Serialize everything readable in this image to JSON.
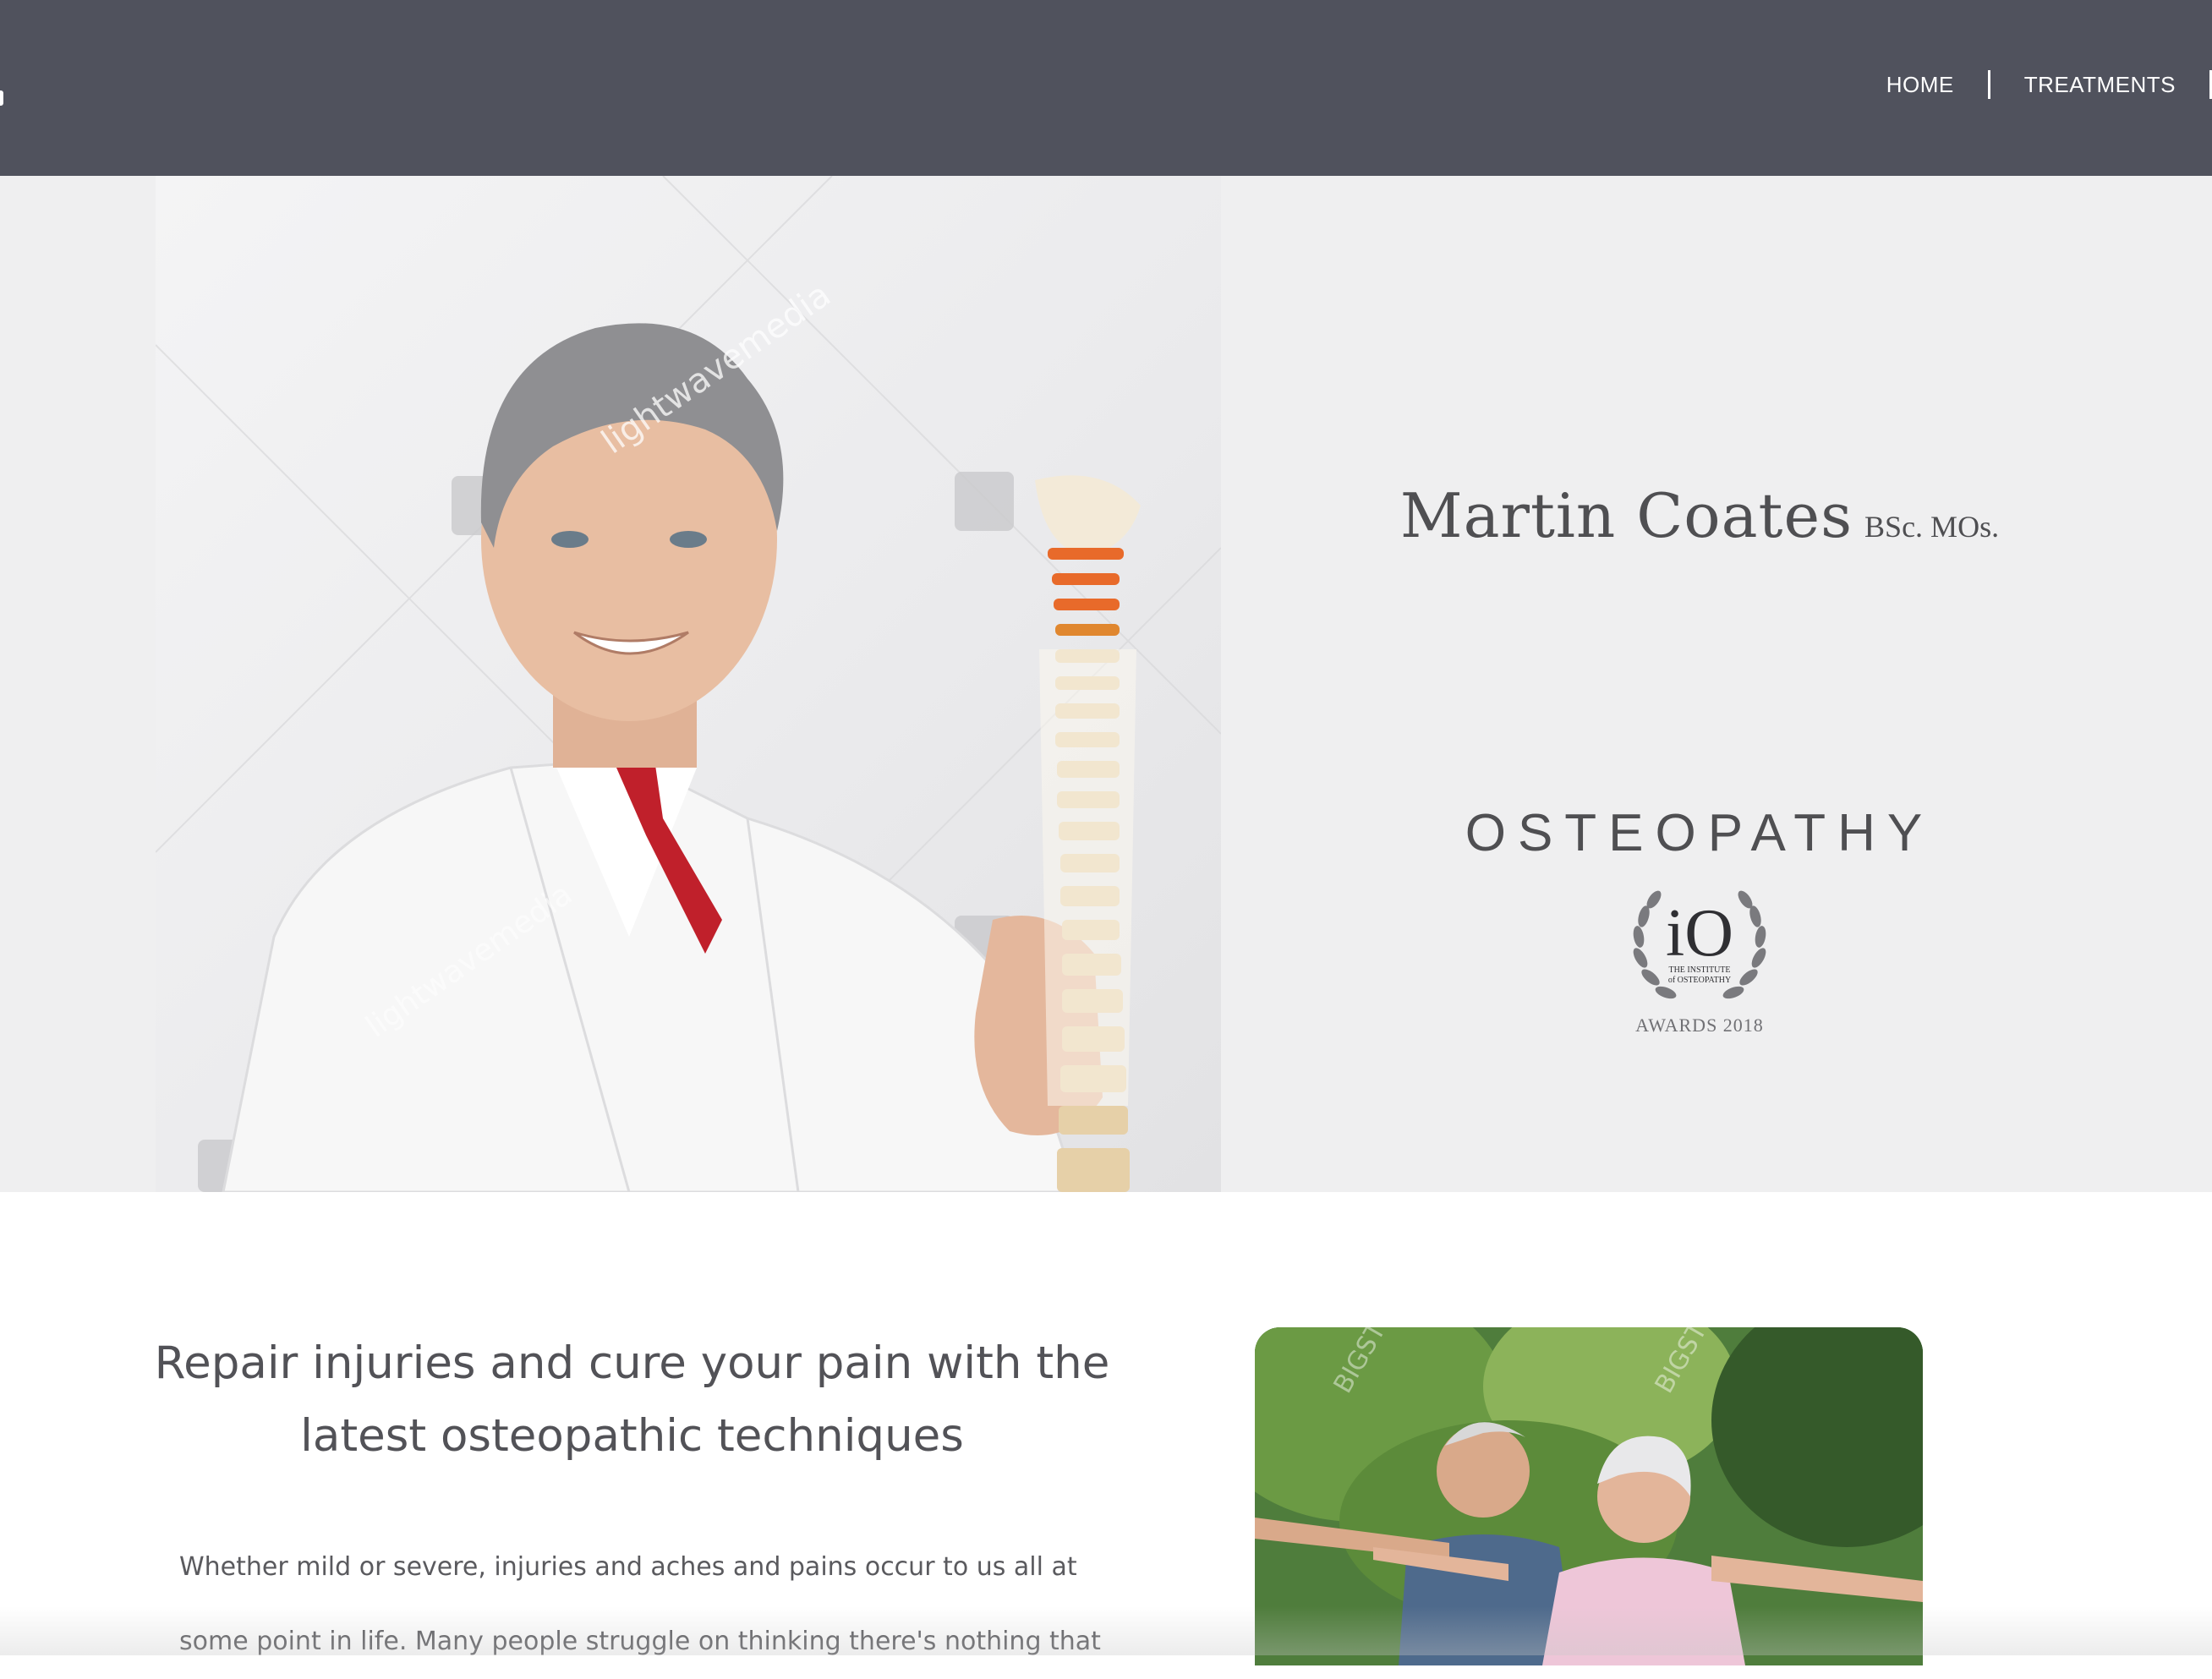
{
  "nav": {
    "items": [
      "HOME",
      "TREATMENTS"
    ]
  },
  "hero": {
    "name": "Martin Coates",
    "qualifications": "BSc. MOs.",
    "practice": "OSTEOPATHY",
    "award": {
      "logo_text": "iO",
      "institute_line1": "THE INSTITUTE",
      "institute_line2": "of OSTEOPATHY",
      "caption": "AWARDS 2018"
    },
    "watermark": "lightwavemedia"
  },
  "intro": {
    "heading_line1": "Repair injuries and cure your pain with the",
    "heading_line2": "latest osteopathic techniques",
    "body_line1": "Whether mild or severe, injuries and aches and pains occur to us all at",
    "body_line2": "some point in life. Many people struggle on thinking there's nothing that",
    "photo_watermark": "BIGSTOCK"
  },
  "colors": {
    "header_bg": "#50525d",
    "hero_bg": "#efeff0",
    "text_dark": "#4f4f52",
    "accent_tie": "#c0202b"
  }
}
